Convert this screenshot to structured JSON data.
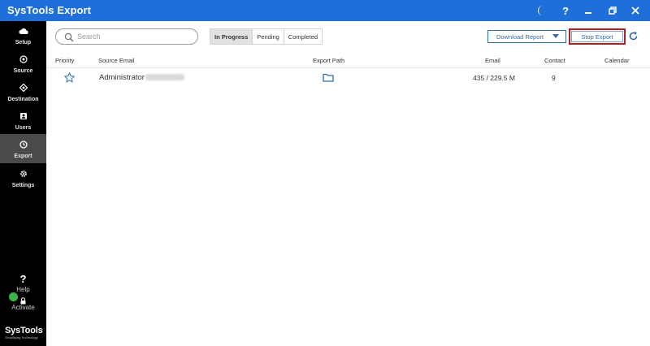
{
  "window": {
    "title": "SysTools Export",
    "controls": [
      "moon-icon",
      "help-icon",
      "minimize-icon",
      "restore-icon",
      "close-icon"
    ]
  },
  "sidebar": {
    "items": [
      {
        "label": "Setup",
        "icon": "cloud-icon"
      },
      {
        "label": "Source",
        "icon": "source-icon"
      },
      {
        "label": "Destination",
        "icon": "destination-icon"
      },
      {
        "label": "Users",
        "icon": "users-icon"
      },
      {
        "label": "Export",
        "icon": "export-clock-icon",
        "active": true
      },
      {
        "label": "Settings",
        "icon": "gear-icon"
      }
    ],
    "help_label": "Help",
    "activate_label": "Activate",
    "brand_name": "SysTools",
    "brand_tagline": "Simplifying Technology"
  },
  "toolbar": {
    "search_placeholder": "Search",
    "tabs": [
      {
        "label": "In Progress",
        "active": true
      },
      {
        "label": "Pending"
      },
      {
        "label": "Completed"
      }
    ],
    "download_report_label": "Download Report",
    "stop_export_label": "Stop Export"
  },
  "table": {
    "columns": [
      "Priority",
      "Source Email",
      "Export Path",
      "Email",
      "Contact",
      "Calendar"
    ],
    "rows": [
      {
        "source_email": "Administrator",
        "email": "435 / 229.5 M",
        "contact": "9",
        "calendar": ""
      }
    ]
  },
  "colors": {
    "titlebar": "#1e6fd9",
    "sidebar": "#000000",
    "accent": "#2f6da6",
    "highlight_border": "#b51d27",
    "activate_dot": "#3ab54a"
  }
}
